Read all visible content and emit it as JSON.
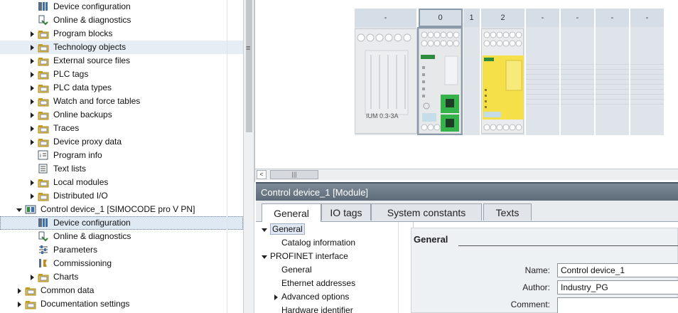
{
  "project_tree": {
    "items": [
      {
        "label": "Device configuration",
        "icon": "device-config-icon",
        "expander": "none",
        "indent": 2
      },
      {
        "label": "Online & diagnostics",
        "icon": "online-diagnostics-icon",
        "expander": "none",
        "indent": 2
      },
      {
        "label": "Program blocks",
        "icon": "folder-icon",
        "expander": "collapsed",
        "indent": 2
      },
      {
        "label": "Technology objects",
        "icon": "folder-icon",
        "expander": "collapsed",
        "indent": 2
      },
      {
        "label": "External source files",
        "icon": "folder-icon",
        "expander": "collapsed",
        "indent": 2
      },
      {
        "label": "PLC tags",
        "icon": "folder-icon",
        "expander": "collapsed",
        "indent": 2
      },
      {
        "label": "PLC data types",
        "icon": "folder-icon",
        "expander": "collapsed",
        "indent": 2
      },
      {
        "label": "Watch and force tables",
        "icon": "folder-icon",
        "expander": "collapsed",
        "indent": 2
      },
      {
        "label": "Online backups",
        "icon": "folder-icon",
        "expander": "collapsed",
        "indent": 2
      },
      {
        "label": "Traces",
        "icon": "folder-icon",
        "expander": "collapsed",
        "indent": 2
      },
      {
        "label": "Device proxy data",
        "icon": "folder-icon",
        "expander": "collapsed",
        "indent": 2
      },
      {
        "label": "Program info",
        "icon": "program-info-icon",
        "expander": "none",
        "indent": 2
      },
      {
        "label": "Text lists",
        "icon": "text-list-icon",
        "expander": "none",
        "indent": 2
      },
      {
        "label": "Local modules",
        "icon": "folder-icon",
        "expander": "collapsed",
        "indent": 2
      },
      {
        "label": "Distributed I/O",
        "icon": "folder-icon",
        "expander": "collapsed",
        "indent": 2
      },
      {
        "label": "Control device_1 [SIMOCODE pro V PN]",
        "icon": "device-icon",
        "expander": "expanded",
        "indent": 1
      },
      {
        "label": "Device configuration",
        "icon": "device-config-icon",
        "expander": "none",
        "indent": 2
      },
      {
        "label": "Online & diagnostics",
        "icon": "online-diagnostics-icon",
        "expander": "none",
        "indent": 2
      },
      {
        "label": "Parameters",
        "icon": "parameters-icon",
        "expander": "none",
        "indent": 2
      },
      {
        "label": "Commissioning",
        "icon": "commissioning-icon",
        "expander": "none",
        "indent": 2
      },
      {
        "label": "Charts",
        "icon": "folder-icon",
        "expander": "collapsed",
        "indent": 2
      },
      {
        "label": "Common data",
        "icon": "folder-icon",
        "expander": "collapsed",
        "indent": 1
      },
      {
        "label": "Documentation settings",
        "icon": "folder-icon",
        "expander": "collapsed",
        "indent": 1
      }
    ],
    "grip_symbol": "≡"
  },
  "device_view": {
    "slots": [
      {
        "label": "-"
      },
      {
        "label": "0"
      },
      {
        "label": "1"
      },
      {
        "label": "2"
      },
      {
        "label": "-"
      },
      {
        "label": "-"
      },
      {
        "label": "-"
      },
      {
        "label": "-"
      }
    ],
    "module_text": "IUM 0.3-3A",
    "scroll_left": "<",
    "scroll_thumb": "|||"
  },
  "inspector": {
    "title": "Control device_1 [Module]",
    "tabs": [
      "General",
      "IO tags",
      "System constants",
      "Texts"
    ],
    "active_tab": "General",
    "nav": [
      {
        "label": "General",
        "expander": "expanded",
        "indent": 0,
        "selected": true
      },
      {
        "label": "Catalog information",
        "expander": "none",
        "indent": 1
      },
      {
        "label": "PROFINET interface",
        "expander": "expanded",
        "indent": 0
      },
      {
        "label": "General",
        "expander": "none",
        "indent": 1
      },
      {
        "label": "Ethernet addresses",
        "expander": "none",
        "indent": 1
      },
      {
        "label": "Advanced options",
        "expander": "collapsed",
        "indent": 1
      },
      {
        "label": "Hardware identifier",
        "expander": "none",
        "indent": 1
      }
    ],
    "section_title": "General",
    "fields": {
      "name_label": "Name:",
      "name_value": "Control device_1",
      "author_label": "Author:",
      "author_value": "Industry_PG",
      "comment_label": "Comment:",
      "comment_value": ""
    }
  },
  "colors": {
    "title_bar": "#5d6b79",
    "selection": "#dfe9f4",
    "module_yellow": "#f5e04a",
    "port_green": "#35b24a"
  }
}
